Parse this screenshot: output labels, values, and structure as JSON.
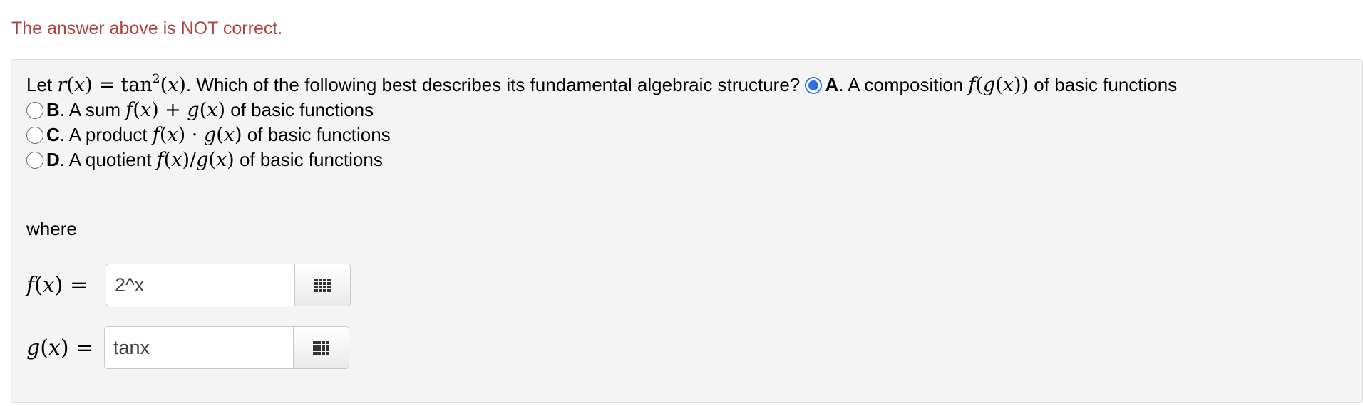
{
  "feedback": {
    "message": "The answer above is NOT correct."
  },
  "question": {
    "prefix": "Let ",
    "function_name": "r",
    "function_arg": "x",
    "equals": " = ",
    "expression_func": "tan",
    "expression_power": "2",
    "expression_arg": "x",
    "suffix": ". Which of the following best describes its fundamental algebraic structure? "
  },
  "options": [
    {
      "letter": "A",
      "text_before": ". A composition ",
      "math": "f(g(x))",
      "text_after": " of basic functions",
      "selected": true
    },
    {
      "letter": "B",
      "text_before": ". A sum ",
      "math": "f(x) + g(x)",
      "text_after": " of basic functions",
      "selected": false
    },
    {
      "letter": "C",
      "text_before": ". A product ",
      "math": "f(x) · g(x)",
      "text_after": " of basic functions",
      "selected": false
    },
    {
      "letter": "D",
      "text_before": ". A quotient ",
      "math": "f(x)/g(x)",
      "text_after": " of basic functions",
      "selected": false
    }
  ],
  "where_label": "where",
  "answers": [
    {
      "label_func": "f",
      "label_arg": "x",
      "label_eq": " =",
      "value": "2^x",
      "palette_icon": "grid-icon"
    },
    {
      "label_func": "g",
      "label_arg": "x",
      "label_eq": " =",
      "value": "tanx",
      "palette_icon": "grid-icon"
    }
  ],
  "colors": {
    "error_text": "#b0423f",
    "panel_bg": "#f4f4f4",
    "radio_selected": "#2f6fe0"
  }
}
